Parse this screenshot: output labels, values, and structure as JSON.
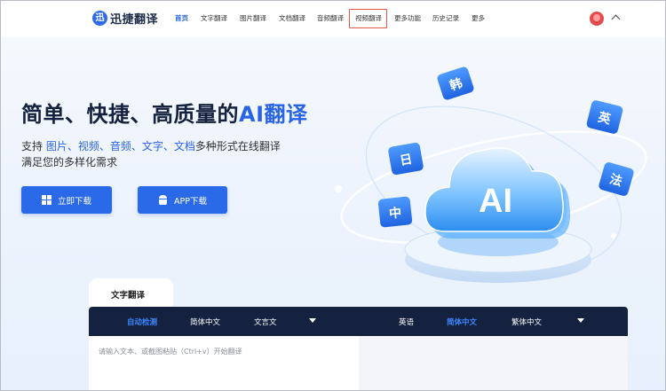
{
  "header": {
    "logo_letter": "迅",
    "logo_text": "迅捷翻译",
    "nav": [
      "首页",
      "文字翻译",
      "图片翻译",
      "文档翻译",
      "音频翻译",
      "视频翻译",
      "更多功能",
      "历史记录",
      "更多"
    ],
    "active_nav": "首页",
    "highlighted_nav": "视频翻译"
  },
  "hero": {
    "title_prefix": "简单、快捷、高质量的",
    "title_accent": "AI翻译",
    "subtitle_line1_prefix": "支持 ",
    "subtitle_highlight": "图片、视频、音频、文字、文档",
    "subtitle_line1_suffix": "多种形式在线翻译",
    "subtitle_line2": "满足您的多样化需求",
    "download_button": "立即下载",
    "app_button": "APP下载"
  },
  "illustration": {
    "cloud_text": "AI",
    "bubbles": [
      "韩",
      "英",
      "日",
      "法",
      "中"
    ]
  },
  "translator": {
    "tab_label": "文字翻译",
    "source_langs": [
      "自动检测",
      "简体中文",
      "文言文"
    ],
    "source_selected": "自动检测",
    "target_langs": [
      "英语",
      "简体中文",
      "繁体中文"
    ],
    "target_selected": "简体中文",
    "input_placeholder": "请输入文本、或截图粘贴（Ctrl+v）开始翻译"
  },
  "colors": {
    "accent": "#2a64e6",
    "button": "#2a6ae9",
    "lang_bar": "#15223f",
    "highlight_border": "#e2574a"
  }
}
